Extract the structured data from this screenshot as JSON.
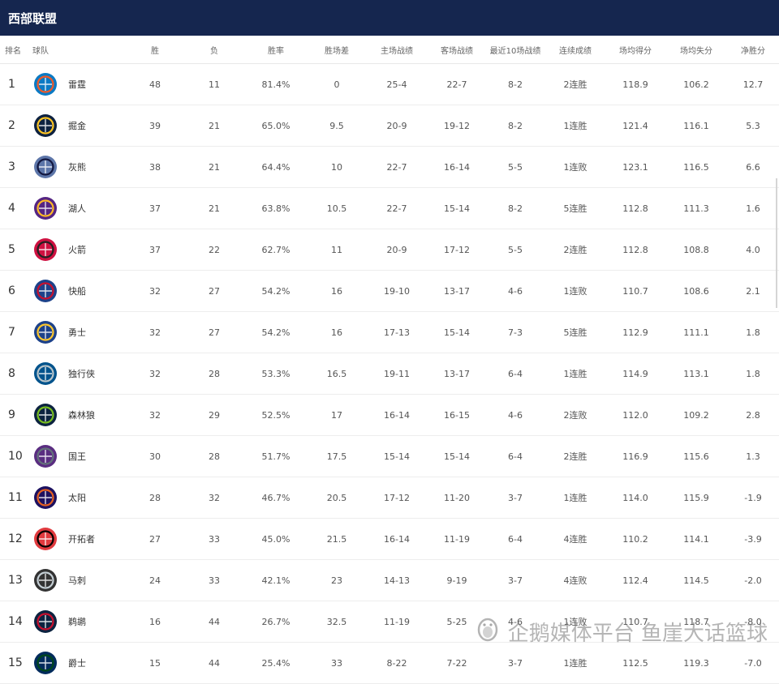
{
  "header": {
    "title": "西部联盟"
  },
  "columns": [
    "排名",
    "球队",
    "胜",
    "负",
    "胜率",
    "胜场差",
    "主场战绩",
    "客场战绩",
    "最近10场战绩",
    "连续成绩",
    "场均得分",
    "场均失分",
    "净胜分"
  ],
  "rows": [
    {
      "rank": "1",
      "team": "雷霆",
      "w": "48",
      "l": "11",
      "pct": "81.4%",
      "gb": "0",
      "home": "25-4",
      "away": "22-7",
      "last10": "8-2",
      "streak": "2连胜",
      "ppg": "118.9",
      "oppg": "106.2",
      "diff": "12.7",
      "logo": "thunder-logo",
      "color": "#0b7ac4",
      "accent": "#f05a28"
    },
    {
      "rank": "2",
      "team": "掘金",
      "w": "39",
      "l": "21",
      "pct": "65.0%",
      "gb": "9.5",
      "home": "20-9",
      "away": "19-12",
      "last10": "8-2",
      "streak": "1连胜",
      "ppg": "121.4",
      "oppg": "116.1",
      "diff": "5.3",
      "logo": "nuggets-logo",
      "color": "#0e2240",
      "accent": "#fec524"
    },
    {
      "rank": "3",
      "team": "灰熊",
      "w": "38",
      "l": "21",
      "pct": "64.4%",
      "gb": "10",
      "home": "22-7",
      "away": "16-14",
      "last10": "5-5",
      "streak": "1连败",
      "ppg": "123.1",
      "oppg": "116.5",
      "diff": "6.6",
      "logo": "grizzlies-logo",
      "color": "#5d76a9",
      "accent": "#12173f"
    },
    {
      "rank": "4",
      "team": "湖人",
      "w": "37",
      "l": "21",
      "pct": "63.8%",
      "gb": "10.5",
      "home": "22-7",
      "away": "15-14",
      "last10": "8-2",
      "streak": "5连胜",
      "ppg": "112.8",
      "oppg": "111.3",
      "diff": "1.6",
      "logo": "lakers-logo",
      "color": "#552583",
      "accent": "#fdb927"
    },
    {
      "rank": "5",
      "team": "火箭",
      "w": "37",
      "l": "22",
      "pct": "62.7%",
      "gb": "11",
      "home": "20-9",
      "away": "17-12",
      "last10": "5-5",
      "streak": "2连胜",
      "ppg": "112.8",
      "oppg": "108.8",
      "diff": "4.0",
      "logo": "rockets-logo",
      "color": "#ce1141",
      "accent": "#222222"
    },
    {
      "rank": "6",
      "team": "快船",
      "w": "32",
      "l": "27",
      "pct": "54.2%",
      "gb": "16",
      "home": "19-10",
      "away": "13-17",
      "last10": "4-6",
      "streak": "1连败",
      "ppg": "110.7",
      "oppg": "108.6",
      "diff": "2.1",
      "logo": "clippers-logo",
      "color": "#1d428a",
      "accent": "#c8102e"
    },
    {
      "rank": "7",
      "team": "勇士",
      "w": "32",
      "l": "27",
      "pct": "54.2%",
      "gb": "16",
      "home": "17-13",
      "away": "15-14",
      "last10": "7-3",
      "streak": "5连胜",
      "ppg": "112.9",
      "oppg": "111.1",
      "diff": "1.8",
      "logo": "warriors-logo",
      "color": "#1d428a",
      "accent": "#ffc72c"
    },
    {
      "rank": "8",
      "team": "独行侠",
      "w": "32",
      "l": "28",
      "pct": "53.3%",
      "gb": "16.5",
      "home": "19-11",
      "away": "13-17",
      "last10": "6-4",
      "streak": "1连胜",
      "ppg": "114.9",
      "oppg": "113.1",
      "diff": "1.8",
      "logo": "mavericks-logo",
      "color": "#00538c",
      "accent": "#b8c4ca"
    },
    {
      "rank": "9",
      "team": "森林狼",
      "w": "32",
      "l": "29",
      "pct": "52.5%",
      "gb": "17",
      "home": "16-14",
      "away": "16-15",
      "last10": "4-6",
      "streak": "2连败",
      "ppg": "112.0",
      "oppg": "109.2",
      "diff": "2.8",
      "logo": "timberwolves-logo",
      "color": "#0c2340",
      "accent": "#78be20"
    },
    {
      "rank": "10",
      "team": "国王",
      "w": "30",
      "l": "28",
      "pct": "51.7%",
      "gb": "17.5",
      "home": "15-14",
      "away": "15-14",
      "last10": "6-4",
      "streak": "2连胜",
      "ppg": "116.9",
      "oppg": "115.6",
      "diff": "1.3",
      "logo": "kings-logo",
      "color": "#5a2d81",
      "accent": "#63727a"
    },
    {
      "rank": "11",
      "team": "太阳",
      "w": "28",
      "l": "32",
      "pct": "46.7%",
      "gb": "20.5",
      "home": "17-12",
      "away": "11-20",
      "last10": "3-7",
      "streak": "1连胜",
      "ppg": "114.0",
      "oppg": "115.9",
      "diff": "-1.9",
      "logo": "suns-logo",
      "color": "#1d1160",
      "accent": "#e56020"
    },
    {
      "rank": "12",
      "team": "开拓者",
      "w": "27",
      "l": "33",
      "pct": "45.0%",
      "gb": "21.5",
      "home": "16-14",
      "away": "11-19",
      "last10": "6-4",
      "streak": "4连胜",
      "ppg": "110.2",
      "oppg": "114.1",
      "diff": "-3.9",
      "logo": "blazers-logo",
      "color": "#e03a3e",
      "accent": "#000000"
    },
    {
      "rank": "13",
      "team": "马刺",
      "w": "24",
      "l": "33",
      "pct": "42.1%",
      "gb": "23",
      "home": "14-13",
      "away": "9-19",
      "last10": "3-7",
      "streak": "4连败",
      "ppg": "112.4",
      "oppg": "114.5",
      "diff": "-2.0",
      "logo": "spurs-logo",
      "color": "#333333",
      "accent": "#c4ced4"
    },
    {
      "rank": "14",
      "team": "鹈鹕",
      "w": "16",
      "l": "44",
      "pct": "26.7%",
      "gb": "32.5",
      "home": "11-19",
      "away": "5-25",
      "last10": "4-6",
      "streak": "1连败",
      "ppg": "110.7",
      "oppg": "118.7",
      "diff": "-8.0",
      "logo": "pelicans-logo",
      "color": "#0c2340",
      "accent": "#c8102e"
    },
    {
      "rank": "15",
      "team": "爵士",
      "w": "15",
      "l": "44",
      "pct": "25.4%",
      "gb": "33",
      "home": "8-22",
      "away": "7-22",
      "last10": "3-7",
      "streak": "1连胜",
      "ppg": "112.5",
      "oppg": "119.3",
      "diff": "-7.0",
      "logo": "jazz-logo",
      "color": "#002b5c",
      "accent": "#00471b"
    }
  ],
  "watermark": {
    "text": "企鹅媒体平台 鱼崖大话篮球",
    "icon": "penguin-icon"
  }
}
